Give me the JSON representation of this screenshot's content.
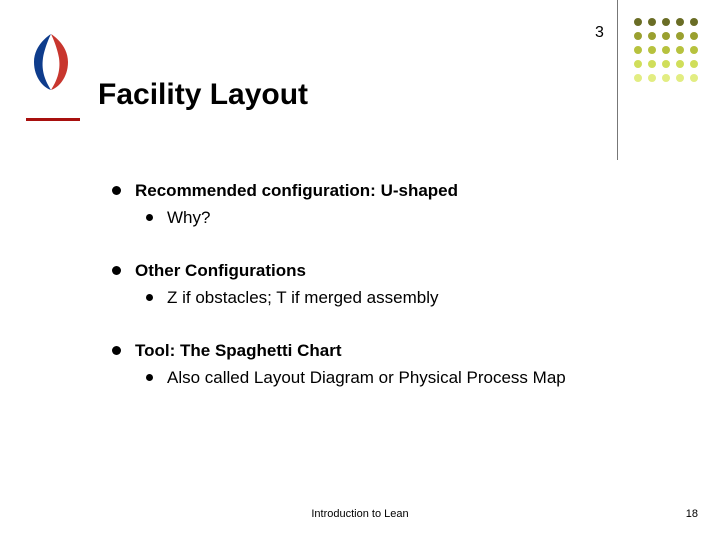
{
  "page_number_top": "3",
  "title": "Facility Layout",
  "bullets": [
    {
      "head": "Recommended configuration: U-shaped",
      "sub": "Why?"
    },
    {
      "head": "Other Configurations",
      "sub": "Z if obstacles; T if merged assembly"
    },
    {
      "head": "Tool: The Spaghetti Chart",
      "sub": "Also called Layout Diagram or Physical Process Map"
    }
  ],
  "footer_center": "Introduction to Lean",
  "footer_right": "18",
  "dot_colors": {
    "row1": "#6A6D25",
    "row2": "#9AA02F",
    "row3": "#B7C23E",
    "row4": "#D0DE5A",
    "row5": "#E2ED82"
  }
}
